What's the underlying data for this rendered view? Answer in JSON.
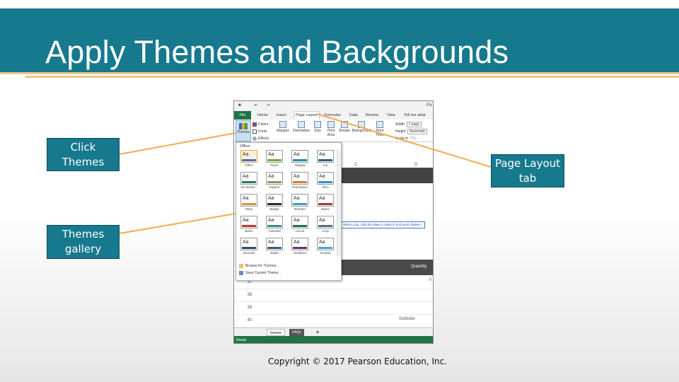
{
  "slide": {
    "title": "Apply Themes and Backgrounds",
    "copyright": "Copyright © 2017 Pearson Education, Inc."
  },
  "callouts": {
    "click_themes": "Click Themes",
    "page_layout_tab": "Page Layout tab",
    "themes_gallery": "Themes gallery"
  },
  "colors": {
    "header": "#17798d",
    "accent_rule": "#e8c690",
    "callout_line": "#f0ad4e",
    "excel_green": "#217346"
  },
  "excel": {
    "qat_icons": [
      "save-icon",
      "undo-icon",
      "redo-icon"
    ],
    "qat_truncated": "Pa",
    "tabs": [
      "File",
      "Home",
      "Insert",
      "Page Layout",
      "Formulas",
      "Data",
      "Review",
      "View"
    ],
    "tell_me": "Tell me what",
    "ribbon": {
      "themes": "Themes",
      "colors": "Colors",
      "fonts": "Fonts",
      "effects": "Effects",
      "margins": "Margins",
      "orientation": "Orientation",
      "size": "Size",
      "print_area": "Print Area",
      "breaks": "Breaks",
      "background": "Background",
      "print_titles": "Print Titles",
      "width_label": "Width:",
      "width_value": "1 page",
      "height_label": "Height:",
      "height_value": "Automatic",
      "scale_label": "Scale to",
      "scale_value": "70%"
    },
    "gallery": {
      "section_label": "Office",
      "themes": [
        {
          "name": "Office",
          "color": "#4472c4"
        },
        {
          "name": "Facet",
          "color": "#6fa93c"
        },
        {
          "name": "Integral",
          "color": "#1c8fb3"
        },
        {
          "name": "Ion",
          "color": "#2c5e8a"
        },
        {
          "name": "Ion Board...",
          "color": "#2a7a6d"
        },
        {
          "name": "Organic",
          "color": "#8a9a5b"
        },
        {
          "name": "Retrospect",
          "color": "#d97b2c"
        },
        {
          "name": "Slice",
          "color": "#3a8fc7"
        },
        {
          "name": "Wisp",
          "color": "#c89b3c"
        },
        {
          "name": "Badge",
          "color": "#2b2b2b"
        },
        {
          "name": "Banded",
          "color": "#3aa0c6"
        },
        {
          "name": "Basis",
          "color": "#a23b2a"
        },
        {
          "name": "Berlin",
          "color": "#c0392b"
        },
        {
          "name": "Celestial",
          "color": "#2f8f8f"
        },
        {
          "name": "Circuit",
          "color": "#1d6b5b"
        },
        {
          "name": "Crop",
          "color": "#5a6e7a"
        },
        {
          "name": "Damask",
          "color": "#2d4a6b"
        },
        {
          "name": "Depth",
          "color": "#3d5a73"
        },
        {
          "name": "Dividend",
          "color": "#5b3a6b"
        },
        {
          "name": "Droplet",
          "color": "#4aa3c9"
        }
      ],
      "browse": "Browse for Themes...",
      "save": "Save Current Theme..."
    },
    "sheet": {
      "col_c": "C",
      "col_d": "D",
      "note": "delete a tip, click the edge to select it and press Delete.)",
      "quantity": "Quantity",
      "quantity_value": "0",
      "subtotal": "Subtotal",
      "row_numbers": [
        "37",
        "38",
        "39",
        "40"
      ]
    },
    "sheet_tabs": [
      "Invoice",
      "FAQs"
    ],
    "status": "Ready"
  }
}
